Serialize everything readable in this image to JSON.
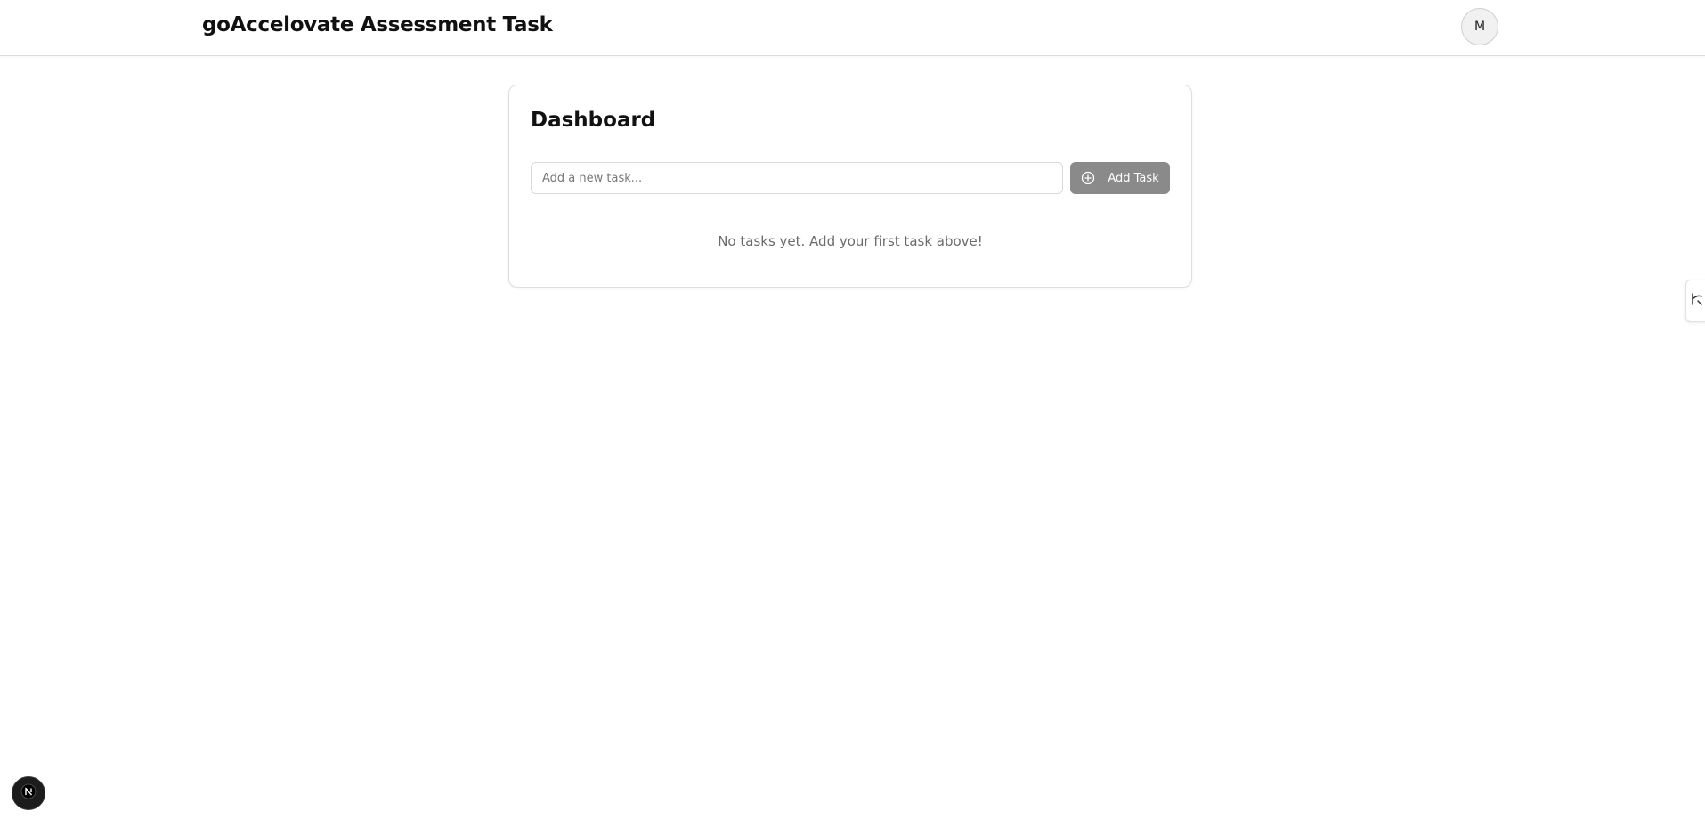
{
  "header": {
    "title": "goAccelovate Assessment Task",
    "avatar_initial": "M"
  },
  "dashboard": {
    "title": "Dashboard",
    "input": {
      "placeholder": "Add a new task...",
      "value": ""
    },
    "add_button": {
      "label": "Add Task",
      "icon": "plus-circle-icon"
    },
    "empty_message": "No tasks yet. Add your first task above!"
  },
  "overlays": {
    "side_tab_icon": "devtools-icon",
    "badge_icon": "nextjs-logo-icon"
  },
  "colors": {
    "button_bg": "#8a8a8a",
    "text_primary": "#111111",
    "text_muted": "#6b6b6b",
    "border": "#dedede"
  }
}
